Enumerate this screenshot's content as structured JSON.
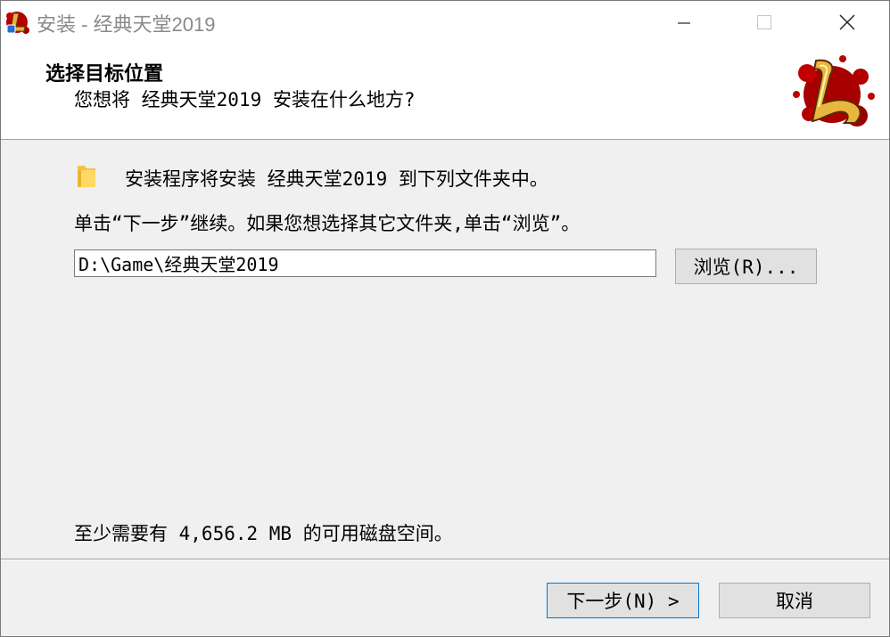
{
  "window": {
    "title": "安装 - 经典天堂2019",
    "icon": "installer-app-icon",
    "controls": {
      "minimize_icon": "minimize-icon",
      "maximize_icon": "maximize-icon",
      "close_icon": "close-icon"
    }
  },
  "header": {
    "title": "选择目标位置",
    "subtitle": "您想将 经典天堂2019 安装在什么地方?",
    "logo_icon": "game-logo-icon"
  },
  "body": {
    "install_line": "安装程序将安装 经典天堂2019 到下列文件夹中。",
    "instruction": "单击“下一步”继续。如果您想选择其它文件夹,单击“浏览”。",
    "folder_icon": "folder-icon",
    "path_value": "D:\\Game\\经典天堂2019",
    "browse_label": "浏览(R)...",
    "disk_space": "至少需要有 4,656.2 MB 的可用磁盘空间。"
  },
  "footer": {
    "next_label": "下一步(N) >",
    "cancel_label": "取消"
  },
  "colors": {
    "focus_border": "#0078d7",
    "dialog_bg": "#f0f0f0",
    "button_bg": "#e1e1e1",
    "title_text": "#8a8a8a"
  }
}
